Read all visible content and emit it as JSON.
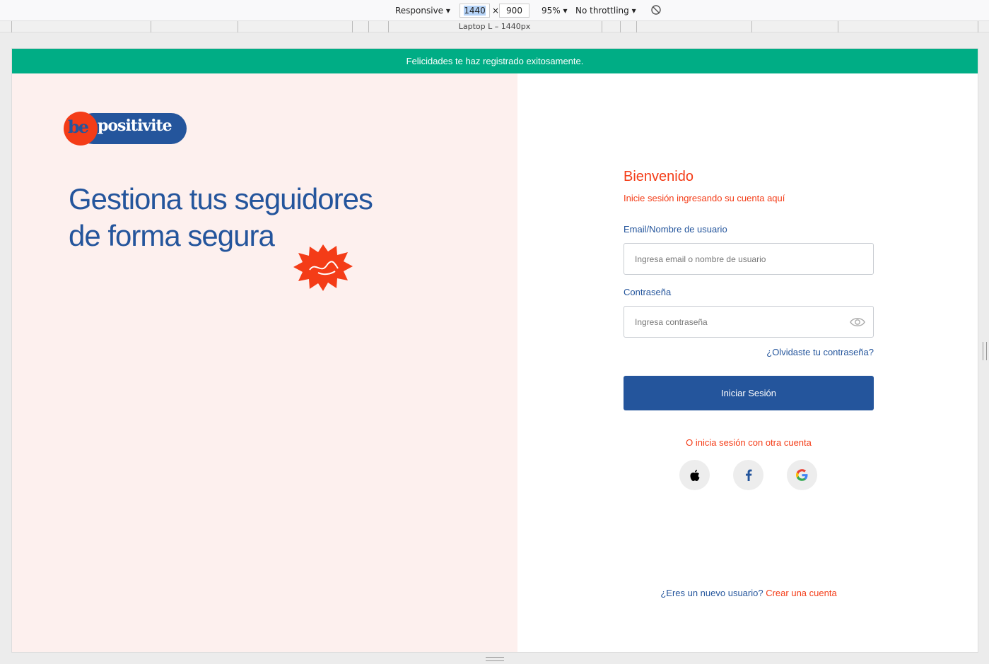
{
  "devtools": {
    "device": "Responsive",
    "width": "1440",
    "times": "×",
    "height": "900",
    "zoom": "95%",
    "throttling": "No throttling",
    "ruler_label": "Laptop L – 1440px"
  },
  "alert": {
    "text": "Felicidades te haz registrado exitosamente."
  },
  "brand": {
    "logo_be": "be",
    "logo_positivite": "positivite"
  },
  "hero": {
    "line1": "Gestiona tus seguidores",
    "line2": "de forma segura"
  },
  "login": {
    "title": "Bienvenido",
    "subtitle": "Inicie sesión ingresando su cuenta aquí",
    "email_label": "Email/Nombre de usuario",
    "email_placeholder": "Ingresa email o nombre de usuario",
    "password_label": "Contraseña",
    "password_placeholder": "Ingresa contraseña",
    "forgot": "¿Olvidaste tu contraseña?",
    "submit": "Iniciar Sesión",
    "other": "O inicia sesión con otra cuenta",
    "social": [
      "apple-icon",
      "facebook-icon",
      "google-icon"
    ],
    "new_user": "¿Eres un nuevo usuario?",
    "create": "Crear una cuenta"
  },
  "colors": {
    "primary": "#24559c",
    "accent": "#f43c17",
    "success": "#00ad85",
    "panel": "#fdf0ee"
  }
}
